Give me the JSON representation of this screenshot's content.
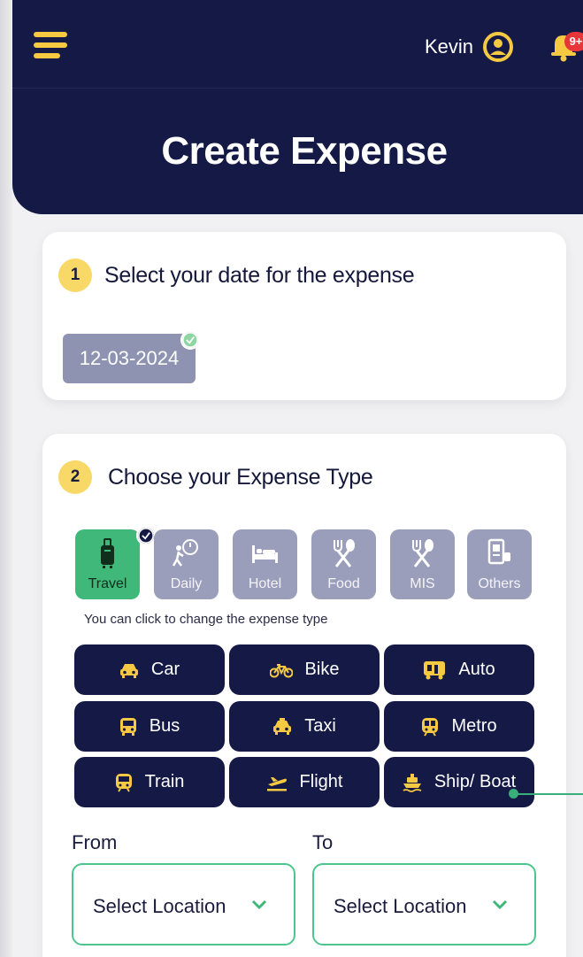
{
  "header": {
    "user_name": "Kevin",
    "notification_count": "9+",
    "title": "Create Expense"
  },
  "step1": {
    "number": "1",
    "label": "Select your date for the expense",
    "date": "12-03-2024"
  },
  "step2": {
    "number": "2",
    "label": "Choose your Expense Type",
    "types": [
      {
        "label": "Travel",
        "icon": "luggage-icon",
        "selected": true
      },
      {
        "label": "Daily",
        "icon": "daily-icon",
        "selected": false
      },
      {
        "label": "Hotel",
        "icon": "bed-icon",
        "selected": false
      },
      {
        "label": "Food",
        "icon": "fork-spoon-icon",
        "selected": false
      },
      {
        "label": "MIS",
        "icon": "fork-spoon-icon",
        "selected": false
      },
      {
        "label": "Others",
        "icon": "receipt-icon",
        "selected": false
      }
    ],
    "hint": "You can click to change the expense type",
    "modes": [
      {
        "label": "Car",
        "icon": "car-icon"
      },
      {
        "label": "Bike",
        "icon": "bike-icon"
      },
      {
        "label": "Auto",
        "icon": "auto-rickshaw-icon"
      },
      {
        "label": "Bus",
        "icon": "bus-icon"
      },
      {
        "label": "Taxi",
        "icon": "taxi-icon"
      },
      {
        "label": "Metro",
        "icon": "metro-icon"
      },
      {
        "label": "Train",
        "icon": "train-icon"
      },
      {
        "label": "Flight",
        "icon": "plane-icon"
      },
      {
        "label": "Ship/ Boat",
        "icon": "ship-icon"
      }
    ],
    "from_label": "From",
    "to_label": "To",
    "from_placeholder": "Select Location",
    "to_placeholder": "Select Location"
  },
  "colors": {
    "navy": "#141a45",
    "accent_yellow": "#f6c943",
    "selected_green": "#3fb87a",
    "tile_gray": "#9a9ebb",
    "badge_red": "#e7363a"
  }
}
